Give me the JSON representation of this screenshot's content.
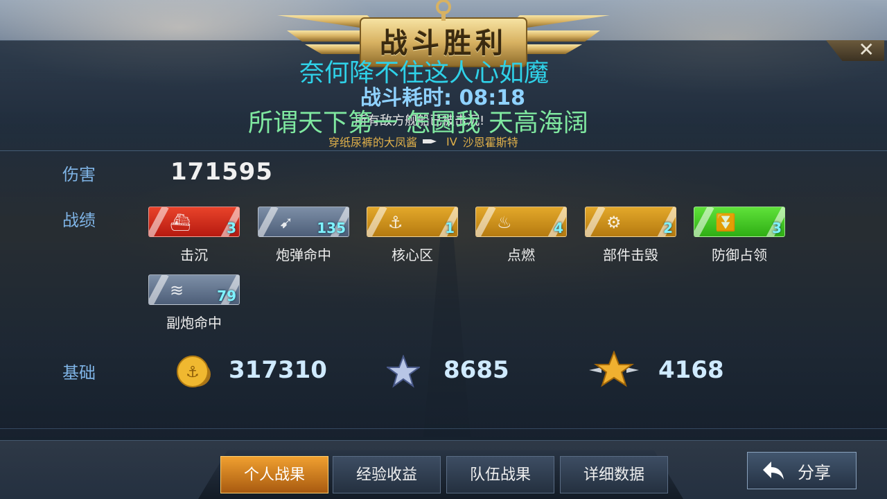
{
  "header": {
    "title": "战斗胜利",
    "overlay_line1": "奈何降不住这人心如魔",
    "overlay_line2": "所谓天下第一 怎圆我 天高海阔",
    "duration_label": "战斗耗时:",
    "duration_value": "08:18",
    "sub_message": "所有敌方舰船已被击沉!",
    "player_name": "穿纸尿裤的大凤酱",
    "ship_tier": "IV",
    "ship_name": "沙恩霍斯特",
    "close_label": "✕"
  },
  "sections": {
    "damage_label": "伤害",
    "damage_value": "171595",
    "record_label": "战绩",
    "base_label": "基础"
  },
  "medals": [
    {
      "name": "击沉",
      "count": "3",
      "color": "red",
      "icon": "sink-ship-icon"
    },
    {
      "name": "炮弹命中",
      "count": "135",
      "color": "steel",
      "icon": "shell-hit-icon"
    },
    {
      "name": "核心区",
      "count": "1",
      "color": "gold",
      "icon": "citadel-icon"
    },
    {
      "name": "点燃",
      "count": "4",
      "color": "gold",
      "icon": "fire-icon"
    },
    {
      "name": "部件击毁",
      "count": "2",
      "color": "gold",
      "icon": "module-destroyed-icon"
    },
    {
      "name": "防御占领",
      "count": "3",
      "color": "green",
      "icon": "defend-capture-icon"
    },
    {
      "name": "副炮命中",
      "count": "79",
      "color": "steel",
      "icon": "secondary-hit-icon"
    }
  ],
  "base": {
    "credits": "317310",
    "experience": "8685",
    "commander_exp": "4168"
  },
  "tabs": [
    {
      "label": "个人战果",
      "active": true
    },
    {
      "label": "经验收益",
      "active": false
    },
    {
      "label": "队伍战果",
      "active": false
    },
    {
      "label": "详细数据",
      "active": false
    }
  ],
  "share_label": "分享",
  "colors": {
    "accent_blue": "#7fb4e6",
    "gold": "#e3a82a",
    "overlay_cyan": "#2fd1e8",
    "overlay_green": "#7fe8a0"
  }
}
